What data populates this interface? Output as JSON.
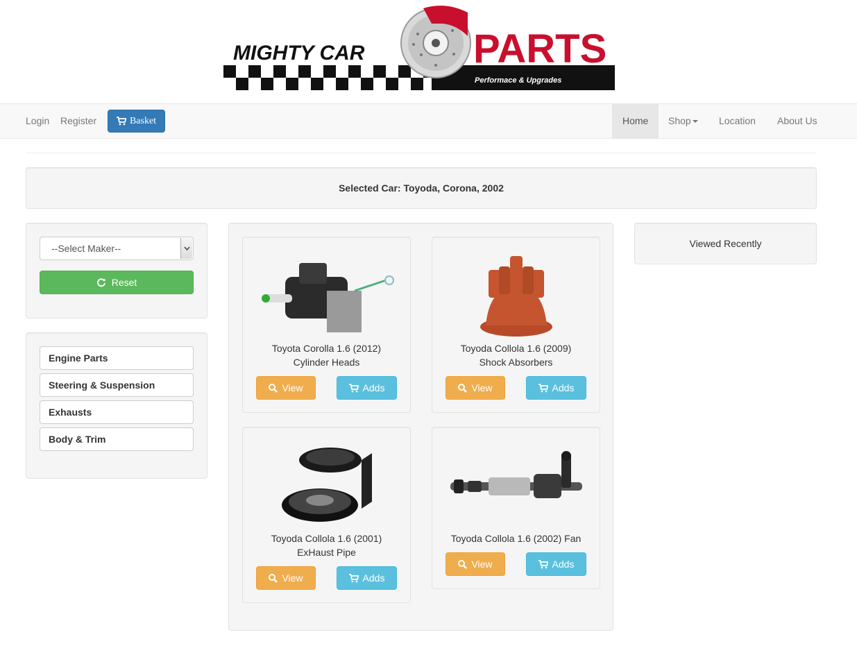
{
  "brand": {
    "name_part1": "MIGHTY CAR",
    "name_part2": "PARTS",
    "tagline": "Performace & Upgrades"
  },
  "nav": {
    "login": "Login",
    "register": "Register",
    "basket": "Basket",
    "home": "Home",
    "shop": "Shop",
    "location": "Location",
    "about": "About Us"
  },
  "selected_car": "Selected Car: Toyoda, Corona, 2002",
  "filter": {
    "maker_select": "--Select Maker--",
    "reset": "Reset"
  },
  "categories": [
    "Engine Parts",
    "Steering & Suspension",
    "Exhausts",
    "Body & Trim"
  ],
  "products": [
    {
      "line1": "Toyota Corolla 1.6 (2012)",
      "line2": "Cylinder Heads",
      "view": "View",
      "add": "Adds",
      "image": "cylinder-head-part"
    },
    {
      "line1": "Toyoda Collola 1.6 (2009)",
      "line2": "Shock Absorbers",
      "view": "View",
      "add": "Adds",
      "image": "distributor-cap-part"
    },
    {
      "line1": "Toyoda Collola 1.6 (2001)",
      "line2": "ExHaust Pipe",
      "view": "View",
      "add": "Adds",
      "image": "horn-part"
    },
    {
      "line1": "Toyoda Collola 1.6 (2002) Fan",
      "line2": "",
      "view": "View",
      "add": "Adds",
      "image": "steering-rack-part"
    }
  ],
  "viewed_recently": "Viewed Recently",
  "colors": {
    "primary": "#337ab7",
    "success": "#5cb85c",
    "warning": "#f0ad4e",
    "info": "#5bc0de",
    "brand_red": "#c8102e"
  }
}
